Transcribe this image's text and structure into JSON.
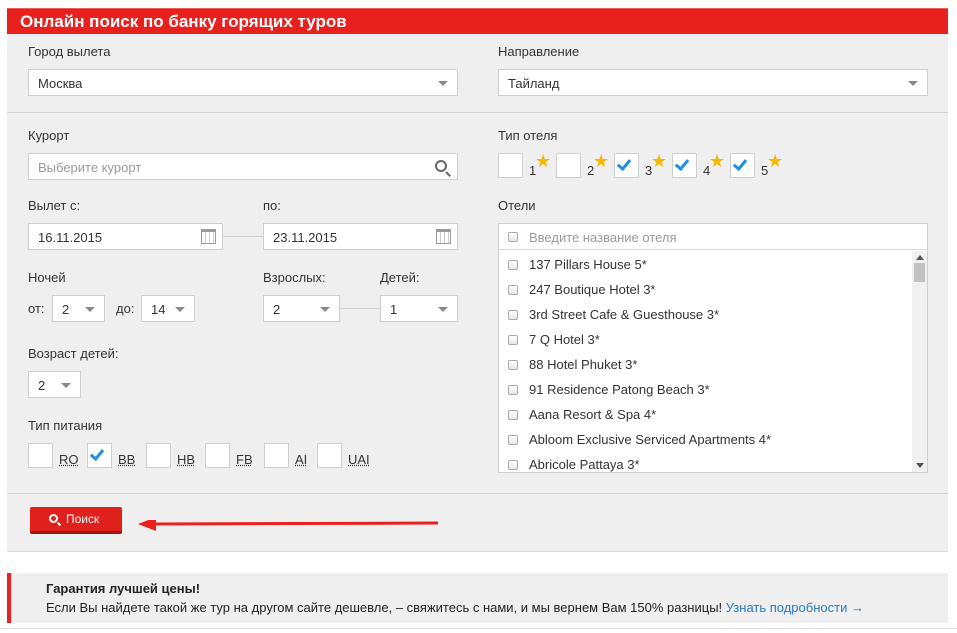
{
  "header": {
    "title": "Онлайн поиск по банку горящих туров"
  },
  "departure": {
    "label": "Город вылета",
    "value": "Москва"
  },
  "destination": {
    "label": "Направление",
    "value": "Тайланд"
  },
  "resort": {
    "label": "Курорт",
    "placeholder": "Выберите курорт"
  },
  "hotel_type": {
    "label": "Тип отеля",
    "options": [
      {
        "num": "1",
        "checked": false
      },
      {
        "num": "2",
        "checked": false
      },
      {
        "num": "3",
        "checked": true
      },
      {
        "num": "4",
        "checked": true
      },
      {
        "num": "5",
        "checked": true
      }
    ]
  },
  "dates": {
    "from_label": "Вылет с:",
    "from_value": "16.11.2015",
    "to_label": "по:",
    "to_value": "23.11.2015"
  },
  "nights": {
    "label": "Ночей",
    "from_label": "от:",
    "from_value": "2",
    "to_label": "до:",
    "to_value": "14"
  },
  "adults": {
    "label": "Взрослых:",
    "value": "2"
  },
  "children": {
    "label": "Детей:",
    "value": "1"
  },
  "children_age": {
    "label": "Возраст детей:",
    "value": "2"
  },
  "meal": {
    "label": "Тип питания",
    "options": [
      {
        "code": "RO",
        "checked": false
      },
      {
        "code": "BB",
        "checked": true
      },
      {
        "code": "HB",
        "checked": false
      },
      {
        "code": "FB",
        "checked": false
      },
      {
        "code": "AI",
        "checked": false
      },
      {
        "code": "UAI",
        "checked": false
      }
    ]
  },
  "hotels": {
    "label": "Отели",
    "placeholder": "Введите название отеля",
    "items": [
      "137 Pillars House 5*",
      "247 Boutique Hotel 3*",
      "3rd Street Cafe & Guesthouse 3*",
      "7 Q Hotel 3*",
      "88 Hotel Phuket 3*",
      "91 Residence Patong Beach 3*",
      "Aana Resort & Spa 4*",
      "Abloom Exclusive Serviced Apartments 4*",
      "Abricole Pattaya 3*"
    ]
  },
  "search_button": {
    "label": "Поиск"
  },
  "guarantee": {
    "title": "Гарантия лучшей цены!",
    "text": "Если Вы найдете такой же тур на другом сайте дешевле, – свяжитесь с нами, и мы вернем Вам 150% разницы!",
    "link": "Узнать подробности →"
  },
  "colors": {
    "brand_red": "#e8201e",
    "check_blue": "#1f8fe0",
    "star_gold": "#f5b800",
    "link_blue": "#2a7ac0"
  }
}
